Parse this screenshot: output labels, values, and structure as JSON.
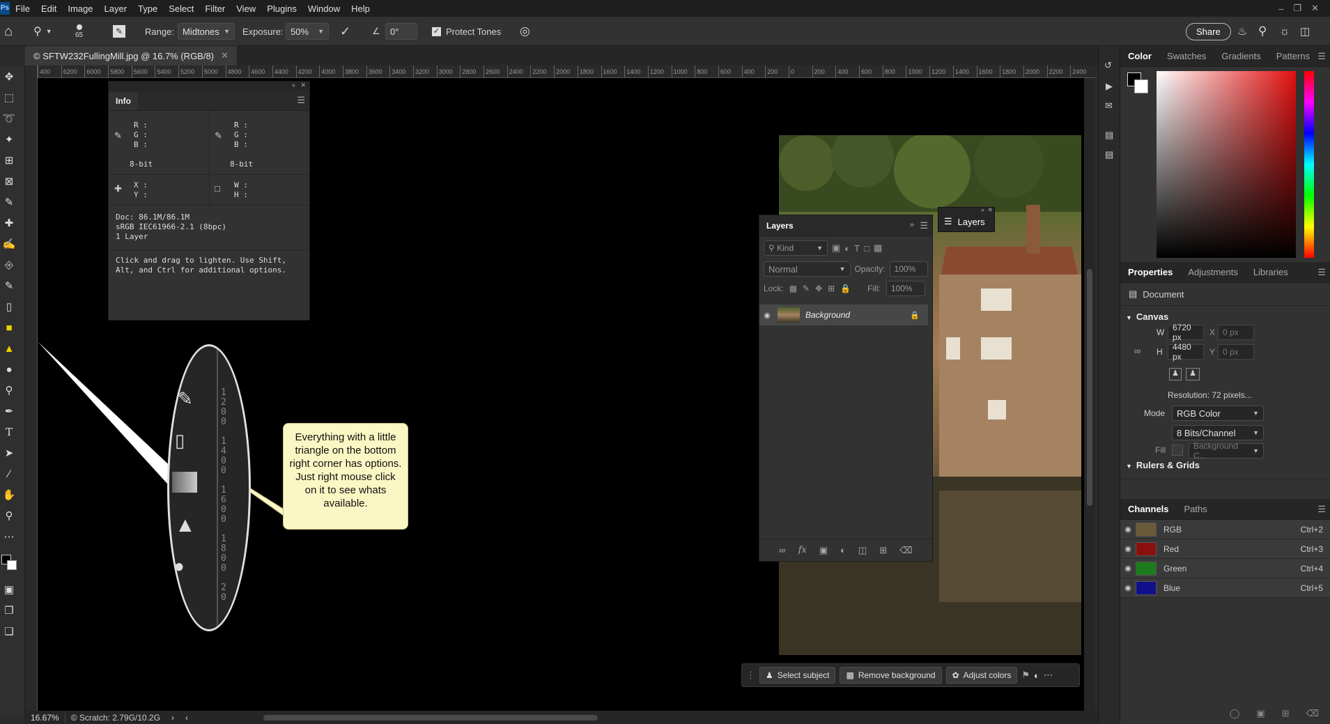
{
  "menubar": {
    "items": [
      "File",
      "Edit",
      "Image",
      "Layer",
      "Type",
      "Select",
      "Filter",
      "View",
      "Plugins",
      "Window",
      "Help"
    ]
  },
  "options": {
    "brush_size": "65",
    "range_label": "Range:",
    "range_value": "Midtones",
    "exposure_label": "Exposure:",
    "exposure_value": "50%",
    "angle_value": "0°",
    "protect_tones": "Protect Tones",
    "share": "Share"
  },
  "document": {
    "tab_title": "© SFTW232FullingMill.jpg @ 16.7% (RGB/8)",
    "zoom": "16.67%",
    "scratch": "© Scratch: 2.79G/10.2G"
  },
  "ruler_ticks": [
    "400",
    "6200",
    "6000",
    "5800",
    "5600",
    "5400",
    "5200",
    "5000",
    "4800",
    "4600",
    "4400",
    "4200",
    "4000",
    "3800",
    "3600",
    "3400",
    "3200",
    "3000",
    "2800",
    "2600",
    "2400",
    "2200",
    "2000",
    "1800",
    "1600",
    "1400",
    "1200",
    "1000",
    "800",
    "600",
    "400",
    "200",
    "0",
    "200",
    "400",
    "600",
    "800",
    "1000",
    "1200",
    "1400",
    "1600",
    "1800",
    "2000",
    "2200",
    "2400"
  ],
  "info": {
    "title": "Info",
    "r": "R :",
    "g": "G :",
    "b": "B :",
    "bit1": "8-bit",
    "bit2": "8-bit",
    "x": "X :",
    "y": "Y :",
    "w": "W :",
    "h": "H :",
    "doc": "Doc: 86.1M/86.1M",
    "profile": "sRGB IEC61966-2.1 (8bpc)",
    "layers": "1 Layer",
    "help": "Click and drag to lighten.  Use Shift, Alt, and Ctrl for additional options."
  },
  "callout": {
    "text": "Everything with a little triangle on the bottom right corner has options.   Just right mouse click on it to see whats available."
  },
  "layers": {
    "title": "Layers",
    "float_title": "Layers",
    "kind": "Kind",
    "blend": "Normal",
    "opacity_label": "Opacity:",
    "opacity": "100%",
    "lock_label": "Lock:",
    "fill_label": "Fill:",
    "fill": "100%",
    "layer_name": "Background"
  },
  "context": {
    "select_subject": "Select subject",
    "remove_bg": "Remove background",
    "adjust_colors": "Adjust colors"
  },
  "color_tabs": [
    "Color",
    "Swatches",
    "Gradients",
    "Patterns"
  ],
  "props": {
    "tabs": [
      "Properties",
      "Adjustments",
      "Libraries"
    ],
    "document": "Document",
    "canvas": "Canvas",
    "w_label": "W",
    "w": "6720 px",
    "h_label": "H",
    "h": "4480 px",
    "x_label": "X",
    "x": "0 px",
    "y_label": "Y",
    "y": "0 px",
    "resolution": "Resolution: 72 pixels...",
    "mode_label": "Mode",
    "mode": "RGB Color",
    "bits": "8 Bits/Channel",
    "fill_label": "Fill",
    "fill": "Background C...",
    "rulers": "Rulers & Grids"
  },
  "channels": {
    "tabs": [
      "Channels",
      "Paths"
    ],
    "rows": [
      {
        "name": "RGB",
        "key": "Ctrl+2",
        "color": "#6b5a3a"
      },
      {
        "name": "Red",
        "key": "Ctrl+3",
        "color": "#8a1010"
      },
      {
        "name": "Green",
        "key": "Ctrl+4",
        "color": "#1d7a1d"
      },
      {
        "name": "Blue",
        "key": "Ctrl+5",
        "color": "#10108a"
      }
    ]
  }
}
